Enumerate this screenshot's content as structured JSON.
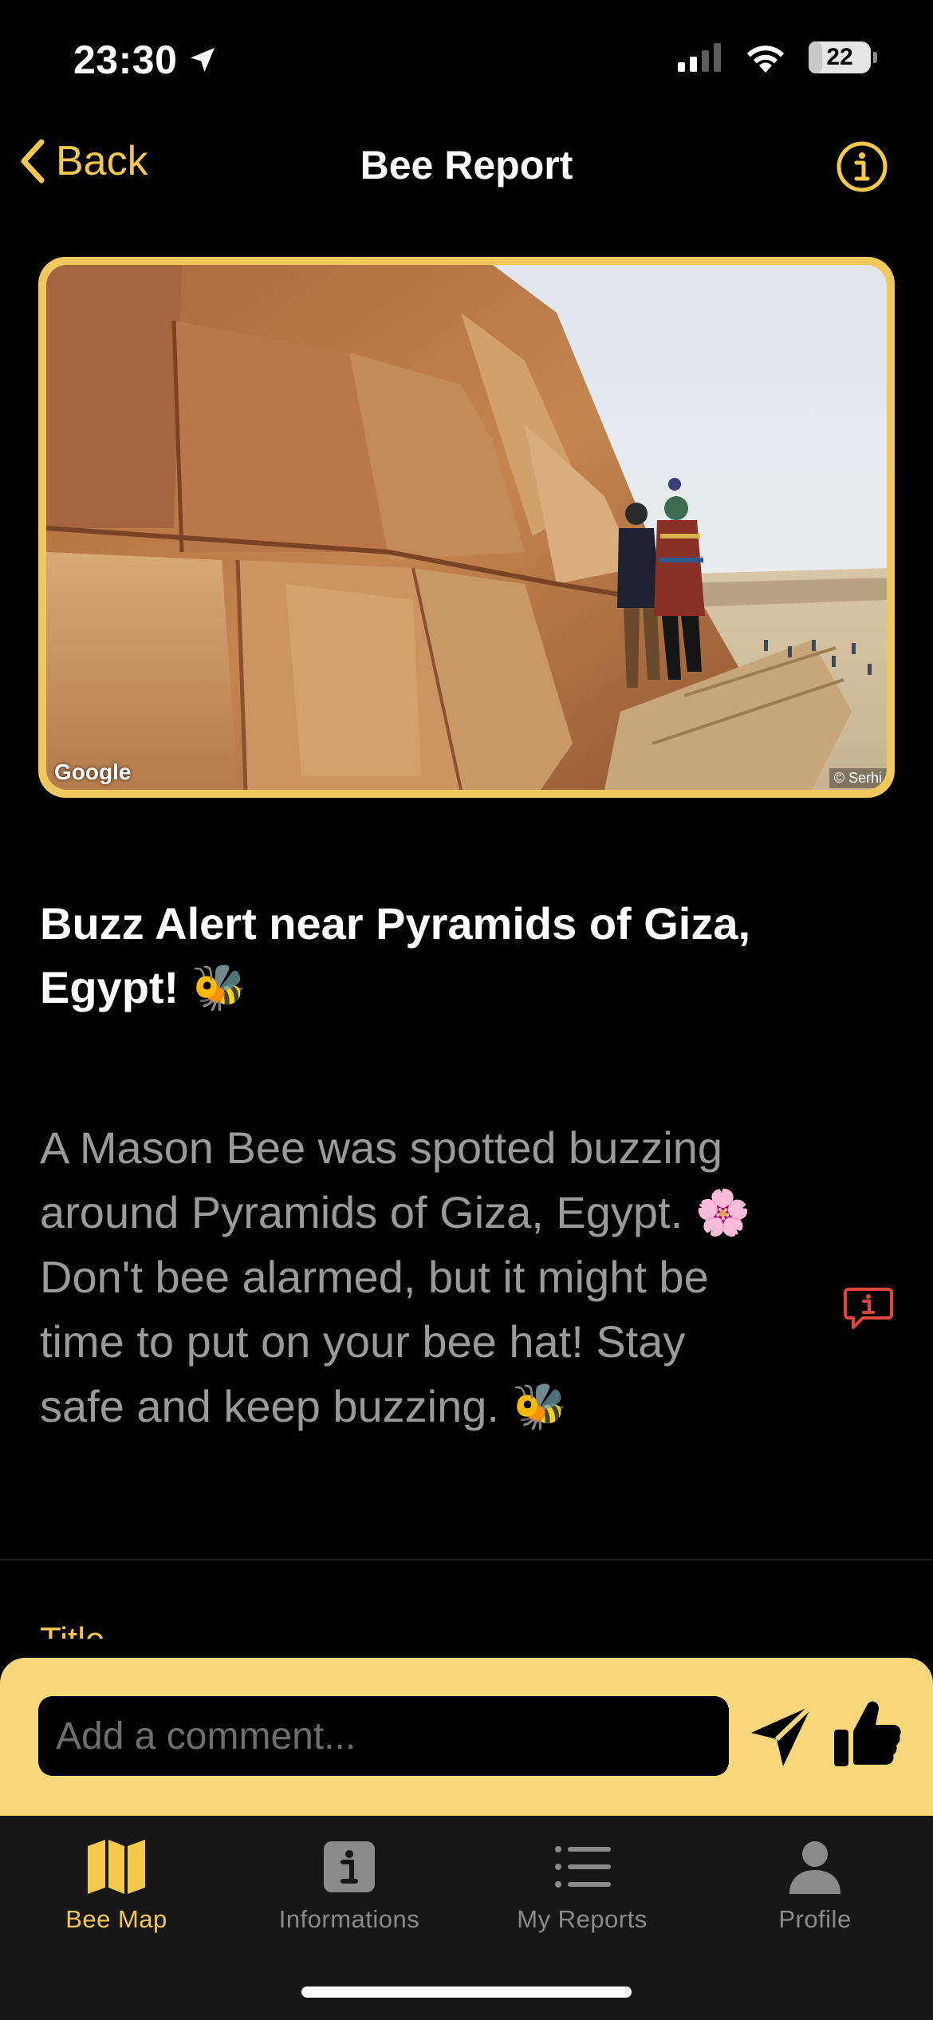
{
  "status_bar": {
    "time": "23:30",
    "battery_level": "22",
    "battery_fraction": 0.22
  },
  "nav": {
    "back_label": "Back",
    "title": "Bee Report",
    "back_icon": "chevron-left-icon",
    "info_icon": "info-circle-icon"
  },
  "photo": {
    "watermark": "Google",
    "copyright": "© Serhi"
  },
  "report": {
    "title": "Buzz Alert near Pyramids of Giza, Egypt! 🐝",
    "body": "A Mason Bee was spotted buzzing around Pyramids of Giza, Egypt. 🌸 Don't bee alarmed, but it might be time to put on your bee hat! Stay safe and keep buzzing. 🐝",
    "report_icon": "report-flag-icon",
    "next_section_label": "Title"
  },
  "comment": {
    "placeholder": "Add a comment...",
    "value": "",
    "send_icon": "send-icon",
    "like_icon": "thumbs-up-icon"
  },
  "tabs": [
    {
      "label": "Bee Map",
      "icon": "map-icon",
      "active": true
    },
    {
      "label": "Informations",
      "icon": "info-square-icon",
      "active": false
    },
    {
      "label": "My Reports",
      "icon": "list-icon",
      "active": false
    },
    {
      "label": "Profile",
      "icon": "person-icon",
      "active": false
    }
  ],
  "colors": {
    "accent": "#f4c84a",
    "comment_bar": "#f9d77b",
    "background": "#000000",
    "tab_bar": "#171717",
    "report_icon": "#e0463a"
  }
}
